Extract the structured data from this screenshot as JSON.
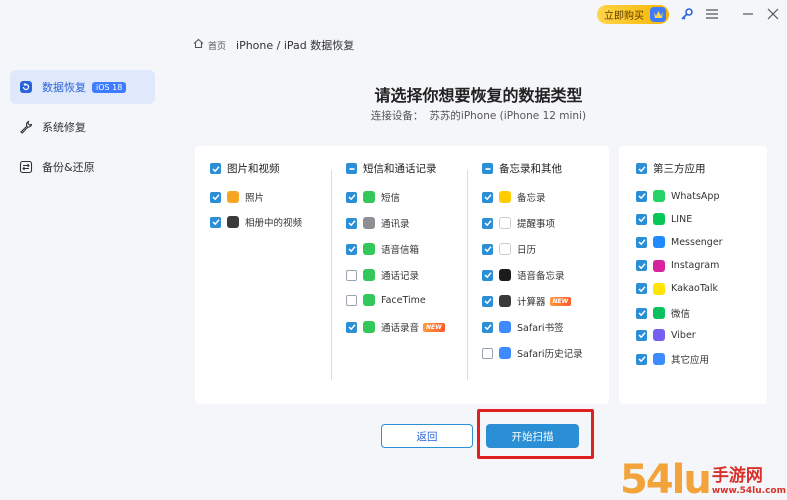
{
  "topbar": {
    "buy_label": "立即购买",
    "icons": [
      "key-icon",
      "menu-icon",
      "minimize-icon",
      "close-icon"
    ]
  },
  "sidebar": {
    "items": [
      {
        "label": "数据恢复",
        "badge": "iOS 18",
        "icon": "restore-icon",
        "active": true
      },
      {
        "label": "系统修复",
        "icon": "wrench-icon",
        "active": false
      },
      {
        "label": "备份&还原",
        "icon": "backup-icon",
        "active": false
      }
    ]
  },
  "breadcrumb": {
    "home": "首页",
    "current": "iPhone / iPad 数据恢复"
  },
  "main": {
    "title": "请选择你想要恢复的数据类型",
    "device_label": "连接设备：",
    "device_value": "苏苏的iPhone (iPhone 12 mini)"
  },
  "columns": [
    {
      "header": "图片和视频",
      "header_state": "on",
      "items": [
        {
          "label": "照片",
          "checked": true,
          "icon": "photos-icon",
          "color": "#f5a623"
        },
        {
          "label": "相册中的视频",
          "checked": true,
          "icon": "video-icon",
          "color": "#3a3a3a"
        }
      ]
    },
    {
      "header": "短信和通话记录",
      "header_state": "partial",
      "items": [
        {
          "label": "短信",
          "checked": true,
          "icon": "messages-icon",
          "color": "#34c759"
        },
        {
          "label": "通讯录",
          "checked": true,
          "icon": "contacts-icon",
          "color": "#8e8e93"
        },
        {
          "label": "语音信箱",
          "checked": true,
          "icon": "voicemail-icon",
          "color": "#34c759"
        },
        {
          "label": "通话记录",
          "checked": false,
          "icon": "phone-icon",
          "color": "#34c759"
        },
        {
          "label": "FaceTime",
          "checked": false,
          "icon": "facetime-icon",
          "color": "#34c759"
        },
        {
          "label": "通话录音",
          "checked": true,
          "icon": "call-record-icon",
          "color": "#34c759",
          "new": "NEW"
        }
      ]
    },
    {
      "header": "备忘录和其他",
      "header_state": "partial",
      "items": [
        {
          "label": "备忘录",
          "checked": true,
          "icon": "notes-icon",
          "color": "#ffcc00"
        },
        {
          "label": "提醒事项",
          "checked": true,
          "icon": "reminders-icon",
          "color": "#ffffff"
        },
        {
          "label": "日历",
          "checked": true,
          "icon": "calendar-icon",
          "color": "#ffffff"
        },
        {
          "label": "语音备忘录",
          "checked": true,
          "icon": "voice-memo-icon",
          "color": "#1c1c1e"
        },
        {
          "label": "计算器",
          "checked": true,
          "icon": "calculator-icon",
          "color": "#3a3a3c",
          "new": "NEW"
        },
        {
          "label": "Safari书签",
          "checked": true,
          "icon": "safari-icon",
          "color": "#3d8bff"
        },
        {
          "label": "Safari历史记录",
          "checked": false,
          "icon": "safari-icon",
          "color": "#3d8bff"
        }
      ]
    },
    {
      "header": "第三方应用",
      "header_state": "on",
      "items": [
        {
          "label": "WhatsApp",
          "checked": true,
          "icon": "whatsapp-icon",
          "color": "#25d366"
        },
        {
          "label": "LINE",
          "checked": true,
          "icon": "line-icon",
          "color": "#06c755"
        },
        {
          "label": "Messenger",
          "checked": true,
          "icon": "messenger-icon",
          "color": "#1f8bff"
        },
        {
          "label": "Instagram",
          "checked": true,
          "icon": "instagram-icon",
          "color": "#d6249f"
        },
        {
          "label": "KakaoTalk",
          "checked": true,
          "icon": "kakaotalk-icon",
          "color": "#fee500"
        },
        {
          "label": "微信",
          "checked": true,
          "icon": "wechat-icon",
          "color": "#07c160"
        },
        {
          "label": "Viber",
          "checked": true,
          "icon": "viber-icon",
          "color": "#7360f2"
        },
        {
          "label": "其它应用",
          "checked": true,
          "icon": "other-apps-icon",
          "color": "#3d8bff"
        }
      ]
    }
  ],
  "buttons": {
    "back": "返回",
    "start": "开始扫描"
  },
  "watermark": {
    "big": "54lu",
    "cn": "手游网",
    "url": "www.54lu.com"
  },
  "colors": {
    "accent": "#2b8fd6",
    "highlight": "#e02020"
  }
}
